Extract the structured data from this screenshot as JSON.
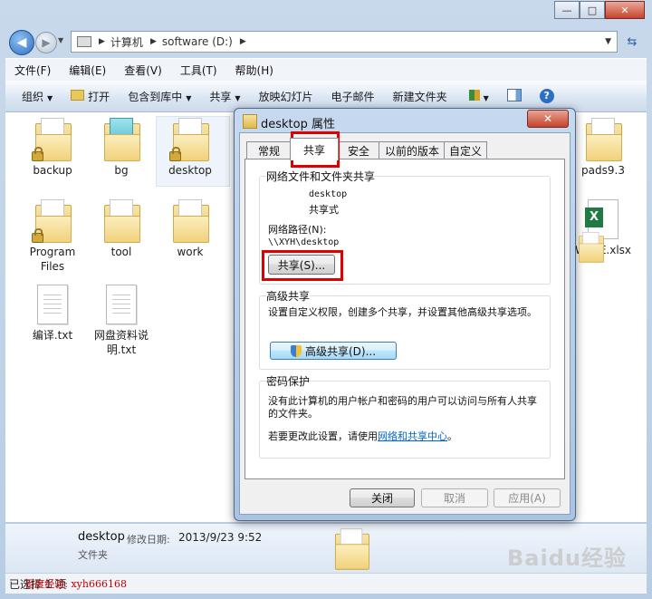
{
  "window": {
    "controls": {
      "minimize": "—",
      "maximize": "□",
      "close": "✕"
    }
  },
  "address": {
    "segments": [
      "计算机",
      "software (D:)"
    ]
  },
  "menu": [
    "文件(F)",
    "编辑(E)",
    "查看(V)",
    "工具(T)",
    "帮助(H)"
  ],
  "commands": {
    "organize": "组织",
    "open": "打开",
    "include": "包含到库中",
    "share": "共享",
    "slideshow": "放映幻灯片",
    "email": "电子邮件",
    "new_folder": "新建文件夹"
  },
  "files": [
    {
      "name": "backup",
      "kind": "folder-lock"
    },
    {
      "name": "bg",
      "kind": "folder-teal"
    },
    {
      "name": "desktop",
      "kind": "folder-lock"
    },
    {
      "name": "pads9.3",
      "kind": "folder"
    },
    {
      "name": "Program Files",
      "kind": "folder-lock"
    },
    {
      "name": "tool",
      "kind": "folder"
    },
    {
      "name": "work",
      "kind": "folder"
    },
    {
      "name": "WAVE.xlsx",
      "kind": "xlsx"
    },
    {
      "name": "编译.txt",
      "kind": "txt"
    },
    {
      "name": "网盘资料说明.txt",
      "kind": "txt"
    }
  ],
  "details": {
    "name": "desktop",
    "date_label": "修改日期:",
    "date": "2013/9/23 9:52",
    "type": "文件夹"
  },
  "status": {
    "text": "已选择 1 项",
    "note": "百度经验: xyh666168"
  },
  "watermark": "Baidu经验",
  "dialog": {
    "title": "desktop 属性",
    "close": "✕",
    "tabs": [
      "常规",
      "共享",
      "安全",
      "以前的版本",
      "自定义"
    ],
    "active_tab": "共享",
    "file_share": {
      "label": "网络文件和文件夹共享",
      "folder_name": "desktop",
      "share_state": "共享式",
      "path_label": "网络路径(N):",
      "path": "\\\\XYH\\desktop",
      "share_button": "共享(S)..."
    },
    "advanced": {
      "label": "高级共享",
      "desc": "设置自定义权限，创建多个共享，并设置其他高级共享选项。",
      "button": "高级共享(D)..."
    },
    "password": {
      "label": "密码保护",
      "desc": "没有此计算机的用户帐户和密码的用户可以访问与所有人共享的文件夹。",
      "change_prefix": "若要更改此设置，请使用",
      "link": "网络和共享中心",
      "change_suffix": "。"
    },
    "buttons": {
      "close": "关闭",
      "cancel": "取消",
      "apply": "应用(A)"
    }
  },
  "highlight_color": "#e00000"
}
